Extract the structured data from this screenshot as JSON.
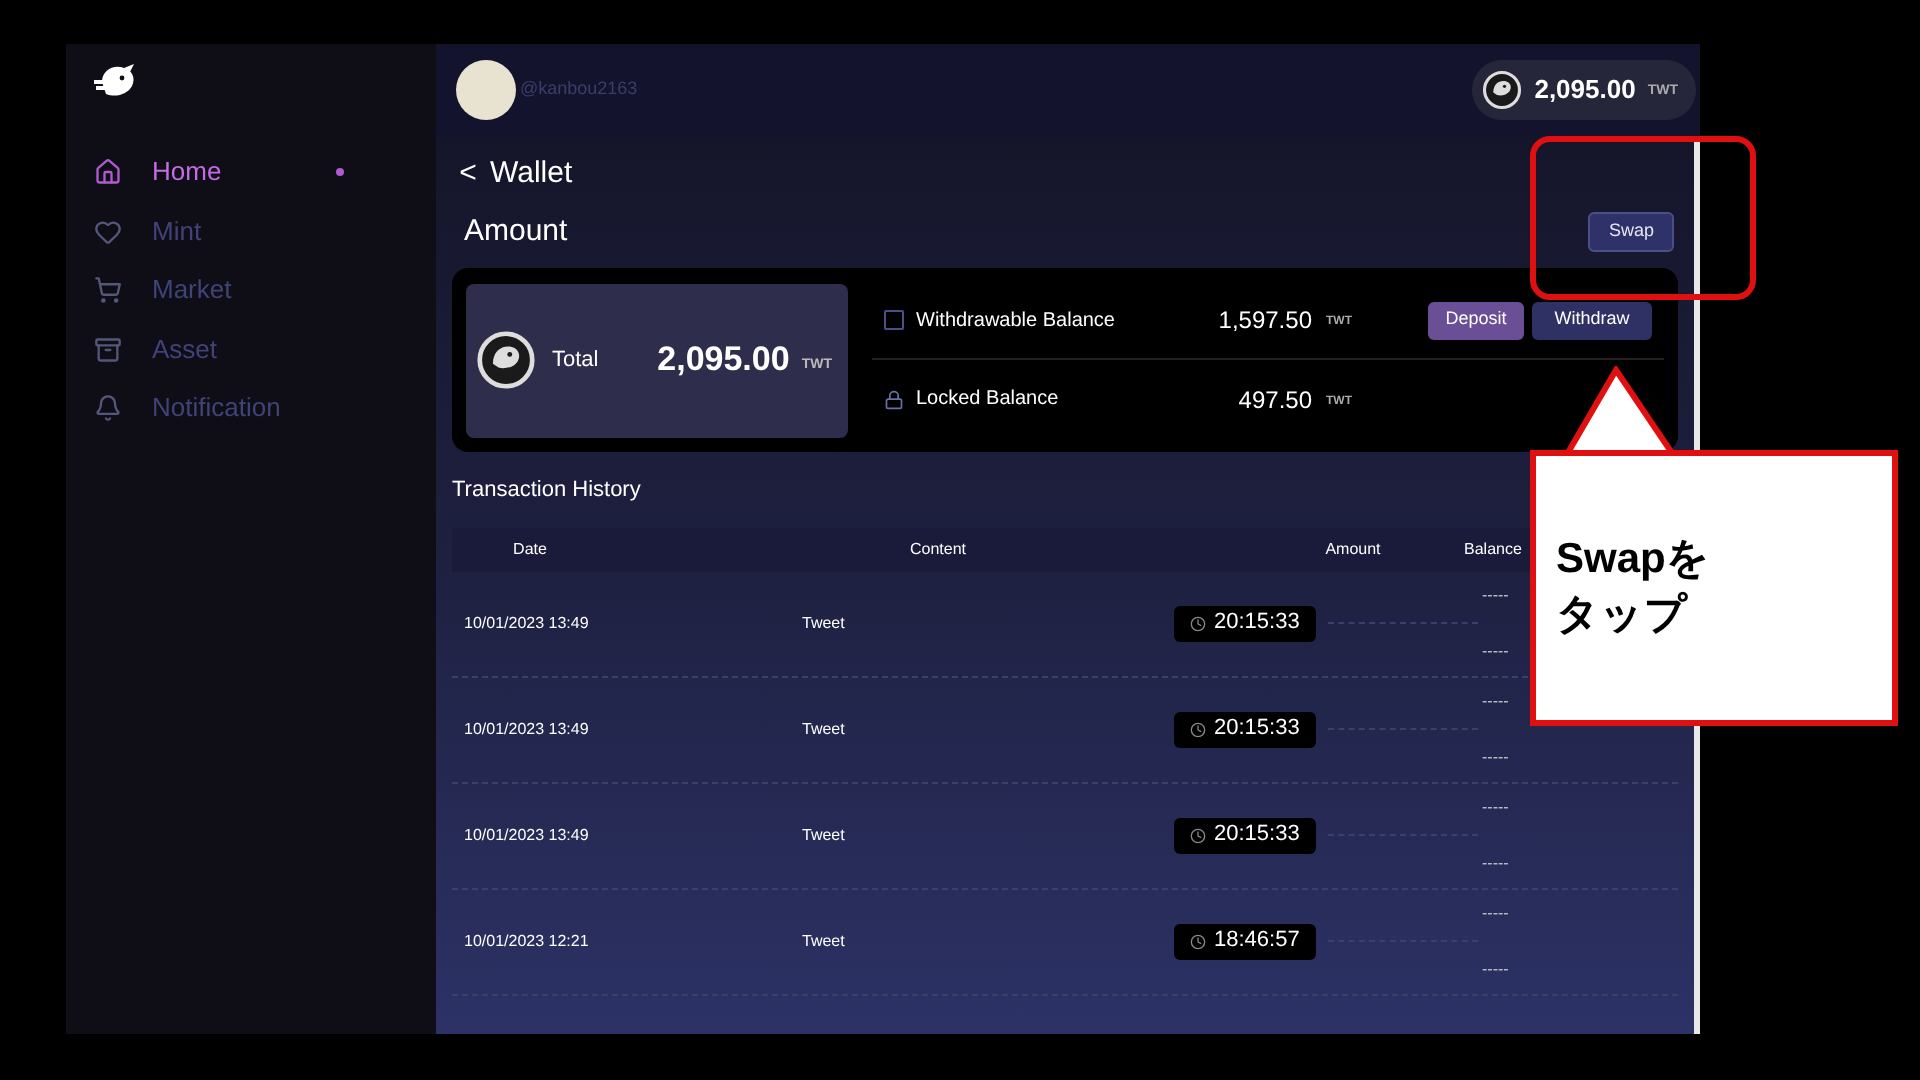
{
  "user": {
    "handle": "@kanbou2163"
  },
  "header_balance": {
    "amount": "2,095.00",
    "unit": "TWT"
  },
  "sidebar": {
    "items": [
      {
        "label": "Home",
        "selected": true
      },
      {
        "label": "Mint",
        "selected": false
      },
      {
        "label": "Market",
        "selected": false
      },
      {
        "label": "Asset",
        "selected": false
      },
      {
        "label": "Notification",
        "selected": false
      }
    ]
  },
  "page": {
    "back": "<",
    "title": "Wallet"
  },
  "amount": {
    "heading": "Amount",
    "swap_button": "Swap",
    "total": {
      "label": "Total",
      "value": "2,095.00",
      "unit": "TWT"
    },
    "balances": [
      {
        "kind": "withdrawable",
        "label": "Withdrawable Balance",
        "value": "1,597.50",
        "unit": "TWT",
        "buttons": [
          "Deposit",
          "Withdraw"
        ]
      },
      {
        "kind": "locked",
        "label": "Locked Balance",
        "value": "497.50",
        "unit": "TWT"
      }
    ]
  },
  "transactions": {
    "title": "Transaction History",
    "columns": [
      "Date",
      "Content",
      "Amount",
      "Balance"
    ],
    "rows": [
      {
        "date": "10/01/2023 13:49",
        "content": "Tweet",
        "amount": "20:15:33",
        "balance": [
          "-----",
          "-----"
        ]
      },
      {
        "date": "10/01/2023 13:49",
        "content": "Tweet",
        "amount": "20:15:33",
        "balance": [
          "-----",
          "-----"
        ]
      },
      {
        "date": "10/01/2023 13:49",
        "content": "Tweet",
        "amount": "20:15:33",
        "balance": [
          "-----",
          "-----"
        ]
      },
      {
        "date": "10/01/2023 12:21",
        "content": "Tweet",
        "amount": "18:46:57",
        "balance": [
          "-----",
          "-----"
        ]
      }
    ]
  },
  "callout": {
    "lines": [
      "Swapを",
      "タップ"
    ]
  }
}
